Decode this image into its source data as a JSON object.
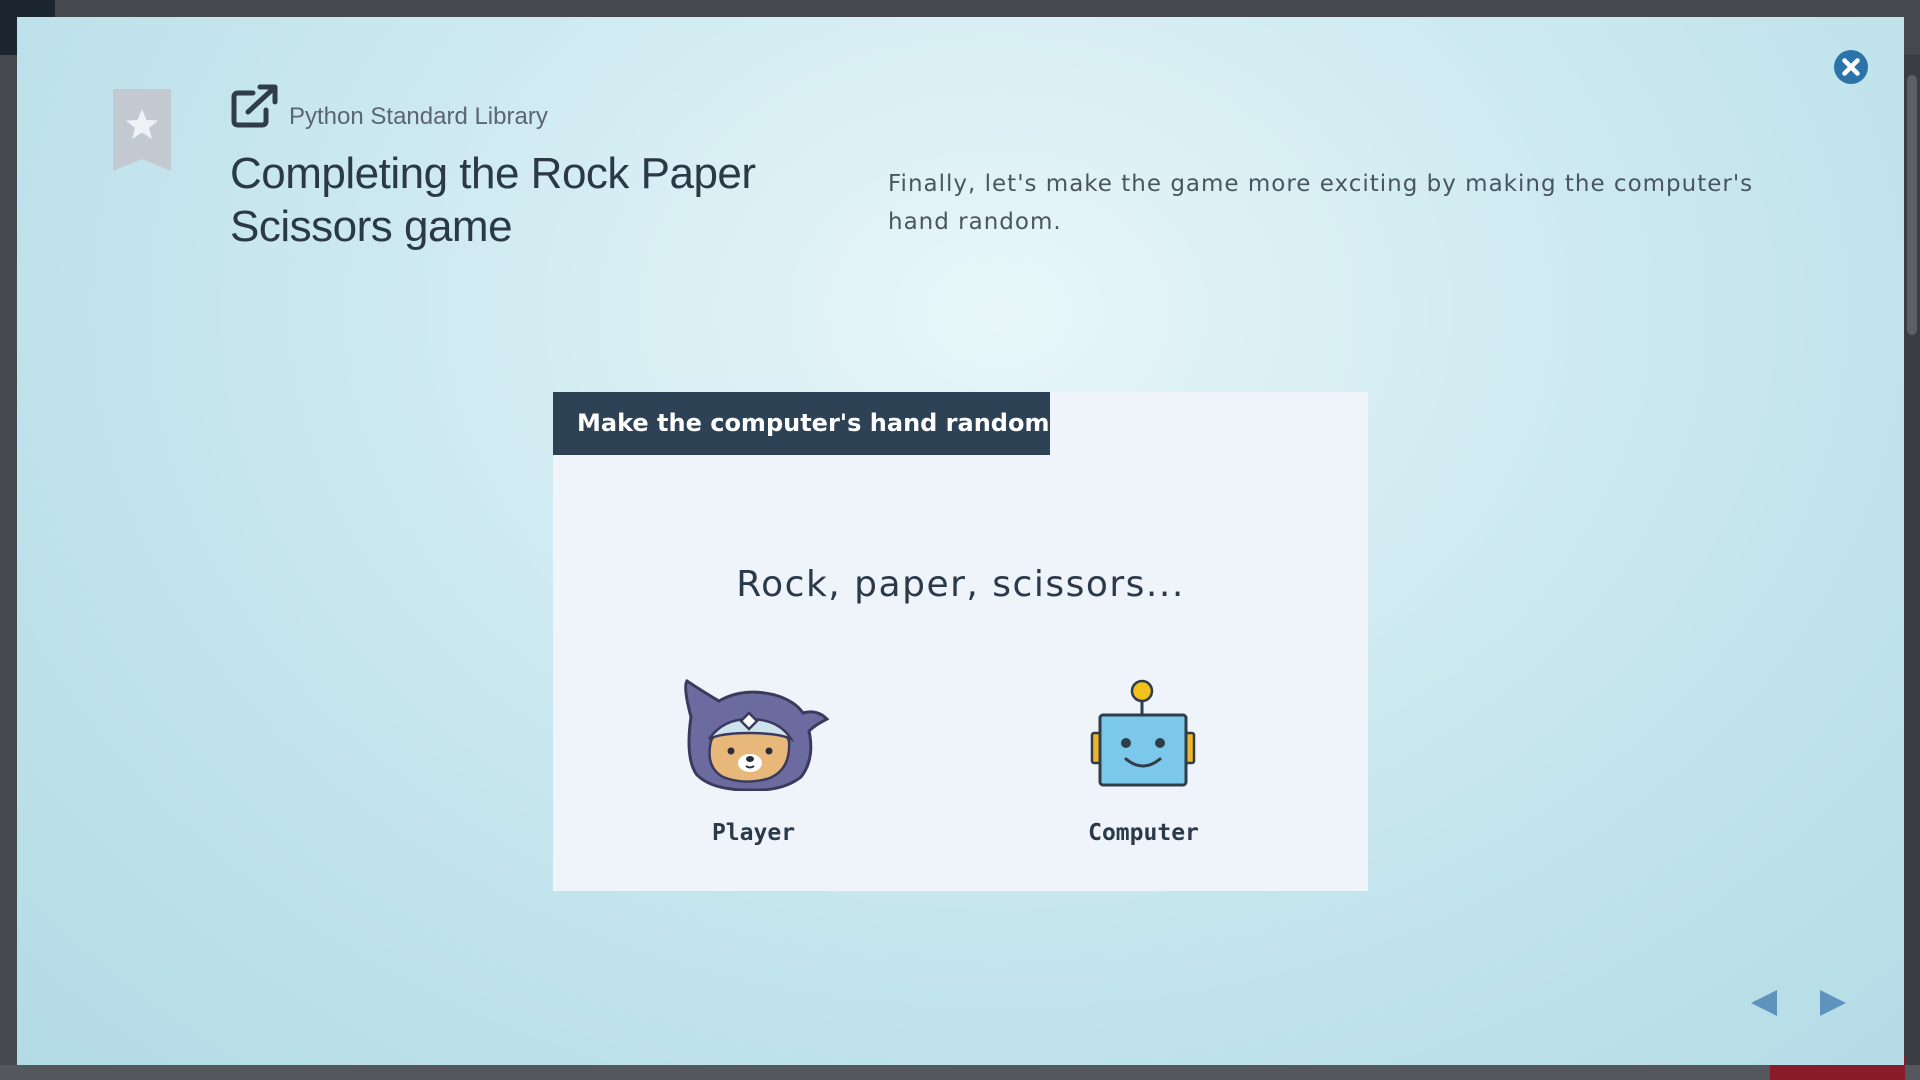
{
  "lesson": {
    "category": "Python Standard Library",
    "title": "Completing the Rock Paper Scissors game",
    "description": "Finally, let's make the game more exciting by making the computer's hand random."
  },
  "card": {
    "header": "Make the computer's hand random",
    "prompt": "Rock, paper, scissors...",
    "player_label": "Player",
    "computer_label": "Computer"
  },
  "icons": {
    "bookmark": "bookmark-star-icon",
    "share": "external-link-icon",
    "close": "close-circle-icon",
    "prev": "triangle-left-icon",
    "next": "triangle-right-icon"
  },
  "colors": {
    "accent": "#2b73a8",
    "card_header_bg": "#2e4256",
    "card_bg": "#eef4f9",
    "nav_arrow": "#5e93bd",
    "bookmark": "#c3c9d0"
  }
}
